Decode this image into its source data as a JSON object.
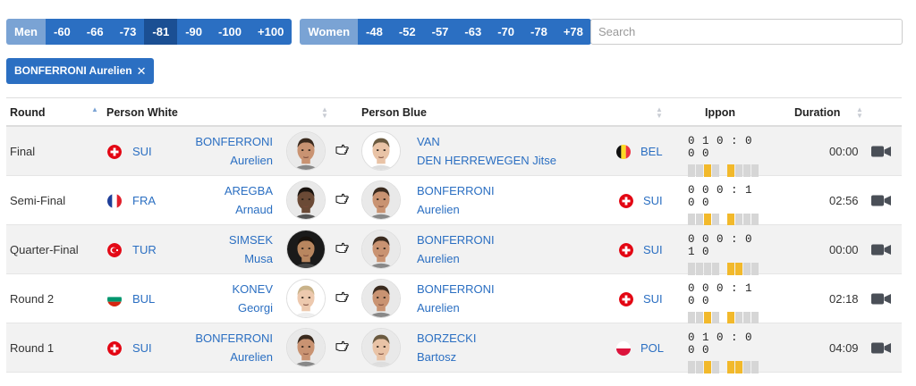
{
  "filters": {
    "men": {
      "label": "Men",
      "options": [
        "-60",
        "-66",
        "-73",
        "-81",
        "-90",
        "-100",
        "+100"
      ],
      "active": "-81"
    },
    "women": {
      "label": "Women",
      "options": [
        "-48",
        "-52",
        "-57",
        "-63",
        "-70",
        "-78",
        "+78"
      ]
    }
  },
  "search": {
    "placeholder": "Search"
  },
  "active_tag": {
    "label": "BONFERRONI Aurelien",
    "close_glyph": "✕"
  },
  "table": {
    "headers": {
      "round": "Round",
      "white": "Person White",
      "blue": "Person Blue",
      "ippon": "Ippon",
      "duration": "Duration"
    },
    "rows": [
      {
        "round": "Final",
        "white": {
          "country": "SUI",
          "flag": "sui",
          "last": "BONFERRONI",
          "first": "Aurelien"
        },
        "winner": "left",
        "blue": {
          "country": "BEL",
          "flag": "bel",
          "last": "VAN",
          "first": "DEN HERREWEGEN Jitse"
        },
        "score": "0 1 0 : 0 0 0",
        "bars_white": [
          0,
          0,
          1,
          0
        ],
        "bars_blue": [
          1,
          0,
          0,
          0
        ],
        "duration": "00:00"
      },
      {
        "round": "Semi-Final",
        "white": {
          "country": "FRA",
          "flag": "fra",
          "last": "AREGBA",
          "first": "Arnaud"
        },
        "winner": "right",
        "blue": {
          "country": "SUI",
          "flag": "sui",
          "last": "BONFERRONI",
          "first": "Aurelien"
        },
        "score": "0 0 0 : 1 0 0",
        "bars_white": [
          0,
          0,
          1,
          0
        ],
        "bars_blue": [
          1,
          0,
          0,
          0
        ],
        "duration": "02:56"
      },
      {
        "round": "Quarter-Final",
        "white": {
          "country": "TUR",
          "flag": "tur",
          "last": "SIMSEK",
          "first": "Musa"
        },
        "winner": "right",
        "blue": {
          "country": "SUI",
          "flag": "sui",
          "last": "BONFERRONI",
          "first": "Aurelien"
        },
        "score": "0 0 0 : 0 1 0",
        "bars_white": [
          0,
          0,
          0,
          0
        ],
        "bars_blue": [
          1,
          1,
          0,
          0
        ],
        "duration": "00:00"
      },
      {
        "round": "Round 2",
        "white": {
          "country": "BUL",
          "flag": "bul",
          "last": "KONEV",
          "first": "Georgi"
        },
        "winner": "right",
        "blue": {
          "country": "SUI",
          "flag": "sui",
          "last": "BONFERRONI",
          "first": "Aurelien"
        },
        "score": "0 0 0 : 1 0 0",
        "bars_white": [
          0,
          0,
          1,
          0
        ],
        "bars_blue": [
          1,
          0,
          0,
          0
        ],
        "duration": "02:18"
      },
      {
        "round": "Round 1",
        "white": {
          "country": "SUI",
          "flag": "sui",
          "last": "BONFERRONI",
          "first": "Aurelien"
        },
        "winner": "left",
        "blue": {
          "country": "POL",
          "flag": "pol",
          "last": "BORZECKI",
          "first": "Bartosz"
        },
        "score": "0 1 0 : 0 0 0",
        "bars_white": [
          0,
          0,
          1,
          0
        ],
        "bars_blue": [
          1,
          1,
          0,
          0
        ],
        "duration": "04:09"
      }
    ]
  },
  "colors": {
    "primary": "#2b6fc2",
    "primary_dark": "#1b4f93",
    "label_bg": "#7aa3d4",
    "shido_yellow": "#f2b92b",
    "bar_grey": "#d6d6d6",
    "row_alt": "#f2f2f2"
  },
  "icons": {
    "winner_hand": "pointing-hand-icon",
    "video": "video-camera-icon",
    "sort": "sort-arrows-icon"
  }
}
